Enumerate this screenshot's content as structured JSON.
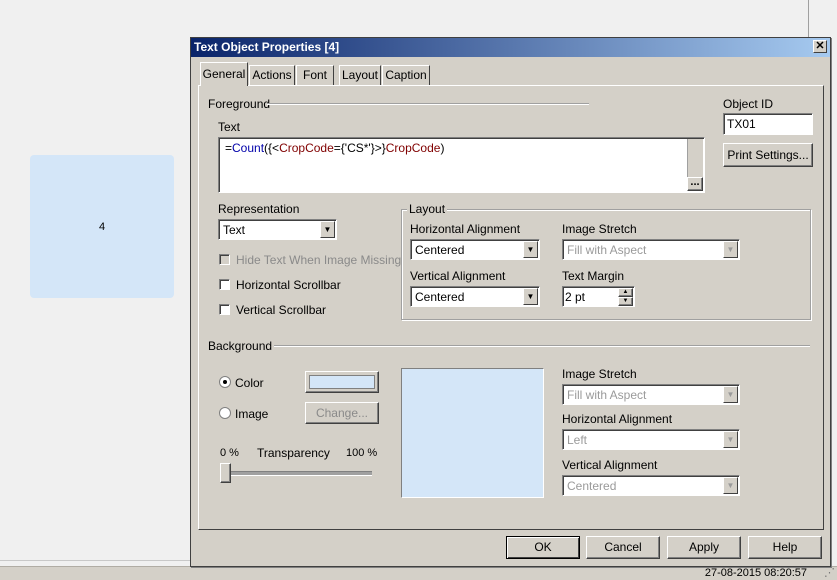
{
  "background": {
    "text_object_value": "4",
    "status_time": "27-08-2015 08:20:57"
  },
  "dialog": {
    "title": "Text Object Properties [4]",
    "close_glyph": "✕",
    "tabs": [
      {
        "label": "General",
        "active": true
      },
      {
        "label": "Actions",
        "active": false
      },
      {
        "label": "Font",
        "active": false
      },
      {
        "label": "Layout",
        "active": false
      },
      {
        "label": "Caption",
        "active": false
      }
    ],
    "foreground": {
      "section_label": "Foreground",
      "text_label": "Text",
      "text_value": {
        "eq": "=",
        "func": "Count",
        "open": "({<",
        "field1": "CropCode",
        "mid": "={'CS*'}>}",
        "field2": "CropCode",
        "close": ")"
      },
      "expand_glyph": "..."
    },
    "object_id": {
      "label": "Object ID",
      "value": "TX01"
    },
    "print_settings_label": "Print Settings...",
    "representation": {
      "label": "Representation",
      "value": "Text"
    },
    "hide_text_label": "Hide Text When Image Missing",
    "horizontal_scrollbar_label": "Horizontal Scrollbar",
    "vertical_scrollbar_label": "Vertical Scrollbar",
    "layout": {
      "group_label": "Layout",
      "h_align_label": "Horizontal Alignment",
      "h_align_value": "Centered",
      "image_stretch_label": "Image Stretch",
      "image_stretch_value": "Fill with Aspect",
      "v_align_label": "Vertical Alignment",
      "v_align_value": "Centered",
      "text_margin_label": "Text Margin",
      "text_margin_value": "2 pt"
    },
    "background": {
      "section_label": "Background",
      "color_label": "Color",
      "image_label": "Image",
      "change_label": "Change...",
      "swatch_color": "#d4e6f8",
      "transparency_label": "Transparency",
      "transparency_min": "0 %",
      "transparency_max": "100 %",
      "transparency_value": 0,
      "image_stretch_label": "Image Stretch",
      "image_stretch_value": "Fill with Aspect",
      "h_align_label": "Horizontal Alignment",
      "h_align_value": "Left",
      "v_align_label": "Vertical Alignment",
      "v_align_value": "Centered"
    },
    "buttons": {
      "ok": "OK",
      "cancel": "Cancel",
      "apply": "Apply",
      "help": "Help"
    }
  },
  "colors": {
    "title_start": "#0a246a",
    "title_end": "#a6caf0",
    "expr_func": "#0000aa",
    "expr_field": "#800000",
    "dialog_face": "#d4d0c8"
  }
}
